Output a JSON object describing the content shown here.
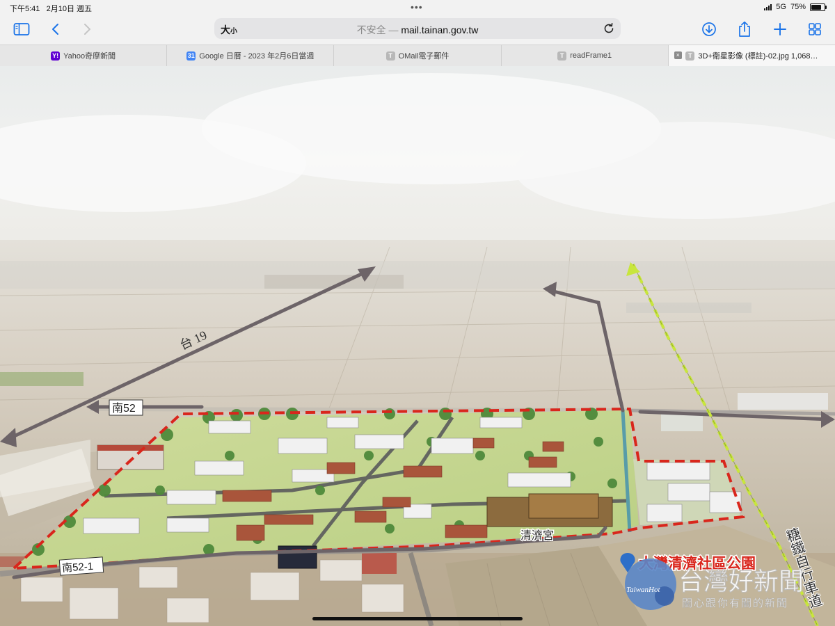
{
  "status_bar": {
    "time": "下午5:41",
    "date": "2月10日 週五",
    "network": "5G",
    "battery": "75%",
    "battery_level": 0.75
  },
  "toolbar": {
    "text_size_label_big": "大",
    "text_size_label_small": "小",
    "security_label": "不安全",
    "separator": " — ",
    "url": "mail.tainan.gov.tw"
  },
  "tabs": [
    {
      "favicon": "Y!",
      "favicon_color": "#6001d2",
      "label": "Yahoo奇摩新聞"
    },
    {
      "favicon": "31",
      "favicon_color": "#4285f4",
      "label": "Google 日曆 - 2023 年2月6日當週"
    },
    {
      "favicon": "T",
      "favicon_color": "#b8b8b8",
      "label": "OMail電子郵件"
    },
    {
      "favicon": "T",
      "favicon_color": "#b8b8b8",
      "label": "readFrame1"
    },
    {
      "favicon": "T",
      "favicon_color": "#b8b8b8",
      "label": "3D+衛星影像 (標註)-02.jpg 1,068…",
      "active": true
    }
  ],
  "image_labels": {
    "road_tai19": "台 19",
    "road_nan52": "南52",
    "road_nan52_1": "南52-1",
    "temple": "清濟宮",
    "park_name": "大灣清濟社區公園",
    "bike_path": "糖鐵自行車道"
  },
  "watermark": {
    "brand_en": "TaiwanHot",
    "brand_zh": "台灣好新聞",
    "slogan": "關心跟你有關的新聞"
  },
  "colors": {
    "accent": "#1a73e8",
    "boundary": "#d9261c",
    "bike_path": "#c8e63c",
    "arrow": "#6d6468",
    "pin": "#2e6fc8"
  }
}
